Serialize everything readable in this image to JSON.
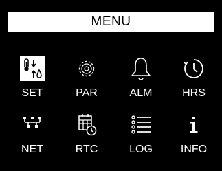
{
  "header": {
    "title": "MENU"
  },
  "menu": {
    "items": [
      {
        "label": "SET",
        "icon": "temperature-humidity-icon",
        "selected": true
      },
      {
        "label": "PAR",
        "icon": "gear-icon",
        "selected": false
      },
      {
        "label": "ALM",
        "icon": "bell-icon",
        "selected": false
      },
      {
        "label": "HRS",
        "icon": "clock-icon",
        "selected": false
      },
      {
        "label": "NET",
        "icon": "network-icon",
        "selected": false
      },
      {
        "label": "RTC",
        "icon": "calendar-clock-icon",
        "selected": false
      },
      {
        "label": "LOG",
        "icon": "list-icon",
        "selected": false
      },
      {
        "label": "INFO",
        "icon": "info-icon",
        "selected": false
      }
    ]
  },
  "colors": {
    "background": "#000000",
    "foreground": "#ffffff",
    "title_bg": "#ffffff",
    "title_text": "#000000"
  }
}
